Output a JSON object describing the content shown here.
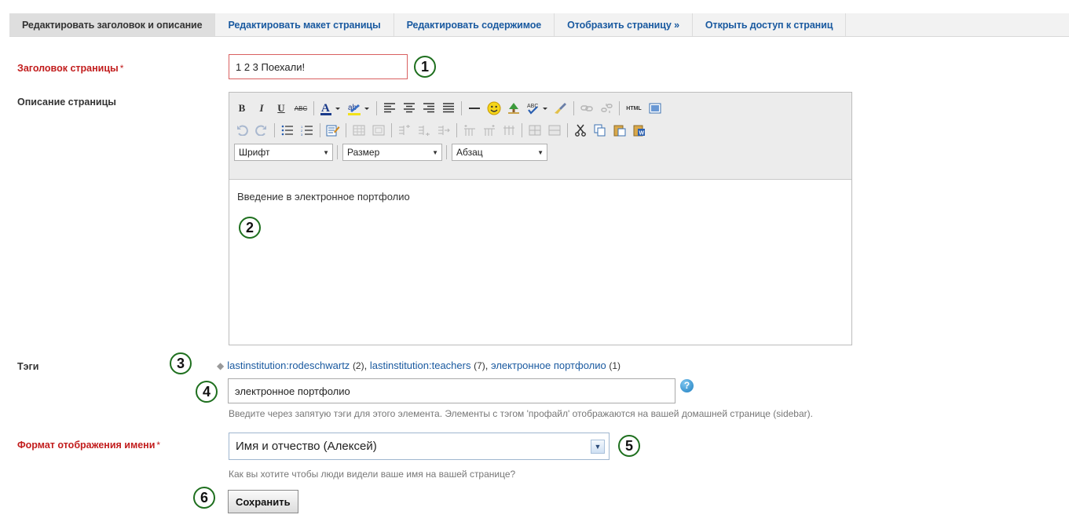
{
  "tabs": [
    {
      "label": "Редактировать заголовок и описание",
      "active": true
    },
    {
      "label": "Редактировать макет страницы"
    },
    {
      "label": "Редактировать содержимое"
    },
    {
      "label": "Отобразить страницу »"
    },
    {
      "label": "Открыть доступ к страниц"
    }
  ],
  "form": {
    "title_label": "Заголовок страницы",
    "required_mark": "*",
    "title_value": "1 2 3 Поехали!",
    "description_label": "Описание страницы",
    "description_text": "Введение в электронное портфолио",
    "tags_label": "Тэги",
    "existing_tags": [
      {
        "name": "lastinstitution:rodeschwartz",
        "count": "(2)"
      },
      {
        "name": "lastinstitution:teachers",
        "count": "(7)"
      },
      {
        "name": "электронное портфолио",
        "count": "(1)"
      }
    ],
    "tags_value": "электронное портфолио",
    "tags_hint": "Введите через запятую тэги для этого элемента. Элементы с тэгом 'профайл' отображаются на вашей домашней странице (sidebar).",
    "name_format_label": "Формат отображения имени",
    "name_format_value": "Имя и отчество (Алексей)",
    "name_format_hint": "Как вы хотите чтобы люди видели ваше имя на вашей странице?",
    "save_label": "Сохранить"
  },
  "editor": {
    "font_select": "Шрифт",
    "size_select": "Размер",
    "format_select": "Абзац"
  },
  "callouts": [
    "1",
    "2",
    "3",
    "4",
    "5",
    "6"
  ],
  "help_glyph": "?",
  "colors": {
    "link": "#1a5aa0",
    "required": "#c21d1d",
    "callout_border": "#1e6f1e"
  }
}
